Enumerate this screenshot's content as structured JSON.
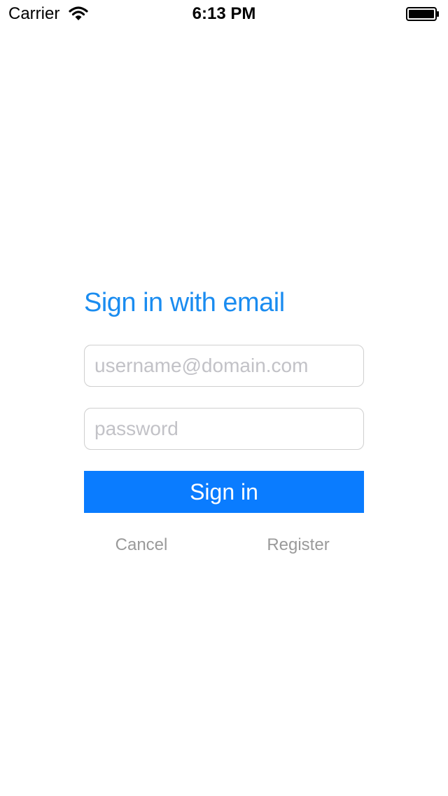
{
  "status_bar": {
    "carrier": "Carrier",
    "time": "6:13 PM",
    "icons": [
      "wifi-icon",
      "battery-icon"
    ]
  },
  "login": {
    "title": "Sign in with email",
    "email_placeholder": "username@domain.com",
    "email_value": "",
    "password_placeholder": "password",
    "password_value": "",
    "sign_in_label": "Sign in",
    "cancel_label": "Cancel",
    "register_label": "Register"
  },
  "colors": {
    "accent": "#0a7cff",
    "title": "#1a8cf0",
    "link": "#9a9a9a",
    "field_border": "#cfcfcf"
  }
}
